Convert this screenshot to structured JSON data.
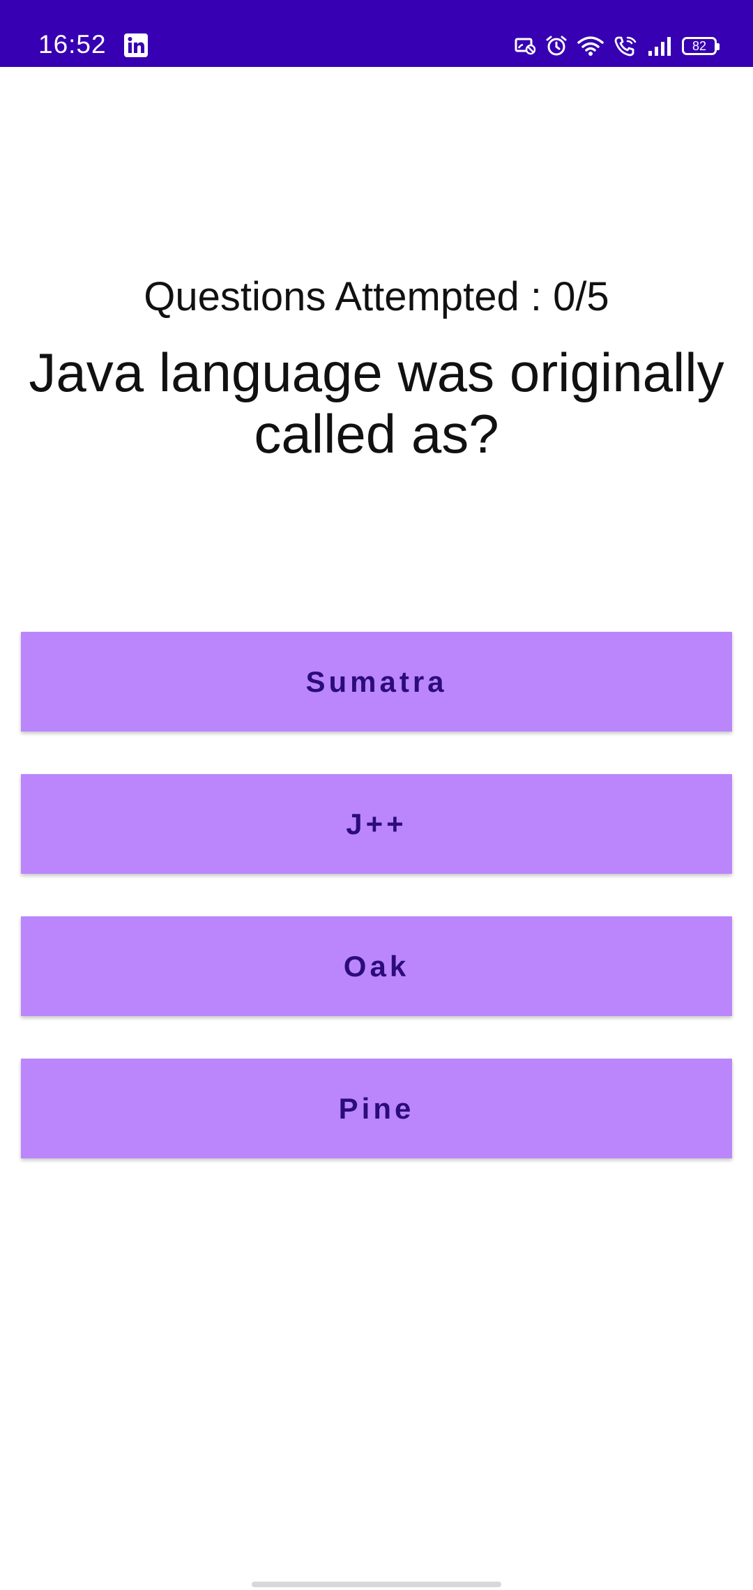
{
  "status_bar": {
    "time": "16:52",
    "battery": "82",
    "icons": [
      "linkedin-icon",
      "cast-off-icon",
      "alarm-icon",
      "wifi-icon",
      "wifi-call-icon",
      "signal-icon",
      "battery-icon"
    ],
    "background": "#3700b3"
  },
  "quiz": {
    "attempted": "Questions Attempted : 0/5",
    "question": "Java language was originally called as?",
    "options": [
      "Sumatra",
      "J++",
      "Oak",
      "Pine"
    ]
  },
  "colors": {
    "option_background": "#bb86fc",
    "option_text": "#2c0b7a"
  }
}
